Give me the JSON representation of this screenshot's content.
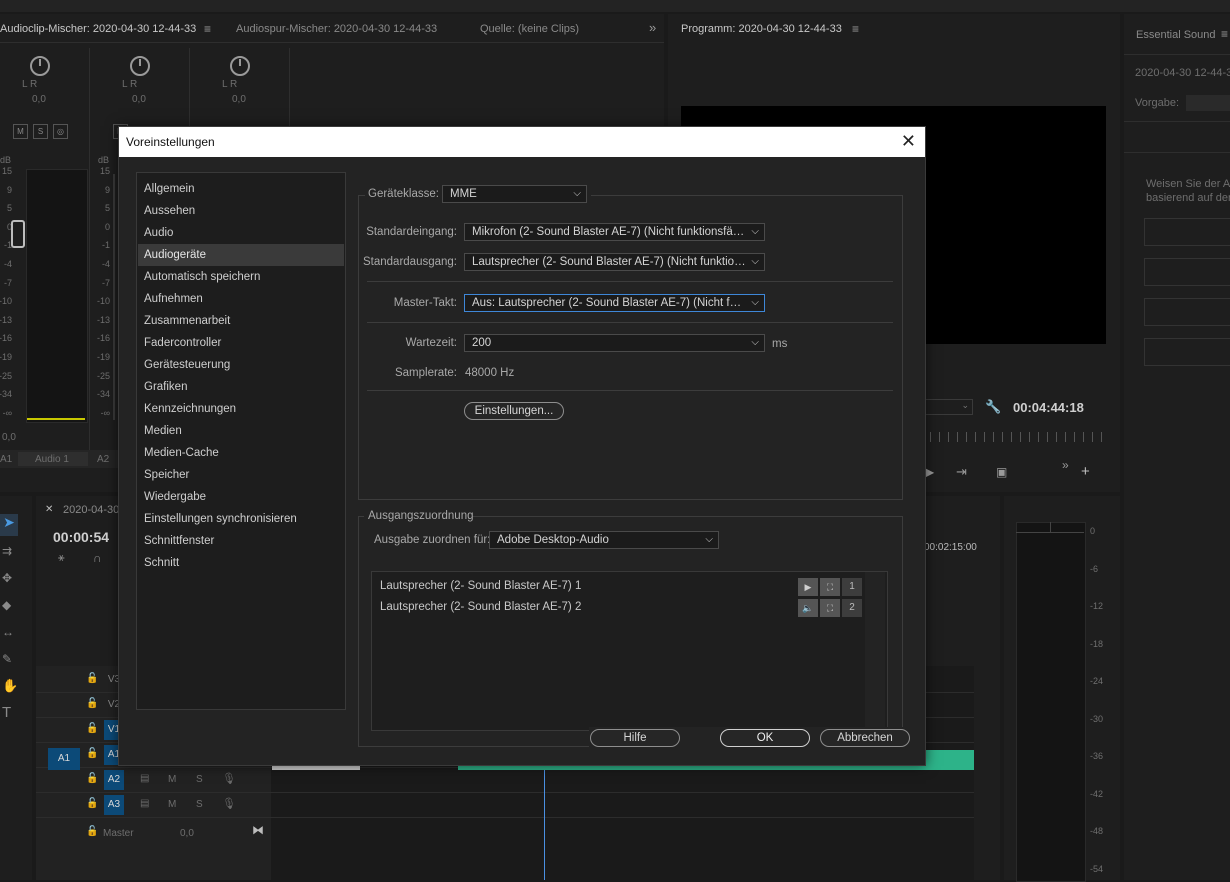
{
  "panels": {
    "audioclip_mixer_tab": "Audioclip-Mischer: 2020-04-30 12-44-33",
    "audiotrack_mixer_tab": "Audiospur-Mischer: 2020-04-30 12-44-33",
    "source_tab": "Quelle: (keine Clips)",
    "program_tab": "Programm: 2020-04-30 12-44-33",
    "essential_sound_tab": "Essential Sound",
    "essential_sound_seq": "2020-04-30 12-44-3",
    "essential_sound_preset": "Vorgabe:",
    "essential_sound_hint1": "Weisen Sie der A",
    "essential_sound_hint2": "basierend auf der",
    "program_timecode": "00:04:44:18",
    "timeline_tab": "2020-04-30",
    "timeline_timecode": "00:00:54",
    "timeline_ruler_time": "00:02:15:00",
    "channel_lr": "L R",
    "pan_value": "0,0",
    "db_label": "dB",
    "mixer_bottom_value": "0,0",
    "mixer_track_a1": "A1",
    "mixer_track_audio1": "Audio 1",
    "mixer_track_a2": "A2",
    "meter_scale": [
      "15",
      "9",
      "5",
      "0",
      "-1",
      "-4",
      "-7",
      "-10",
      "-13",
      "-16",
      "-19",
      "-25",
      "-34",
      "-∞"
    ],
    "right_meter_scale": [
      "0",
      "-6",
      "-12",
      "-18",
      "-24",
      "-30",
      "-36",
      "-42",
      "-48",
      "-54"
    ],
    "tracks": [
      "V3",
      "V2",
      "V1",
      "A1",
      "A2",
      "A3"
    ],
    "track_master": "Master",
    "track_master_value": "0,0",
    "source_patch_a1": "A1",
    "m_label": "M",
    "s_label": "S",
    "solo_label": "S"
  },
  "dialog": {
    "title": "Voreinstellungen",
    "close_glyph": "✕",
    "categories": [
      "Allgemein",
      "Aussehen",
      "Audio",
      "Audiogeräte",
      "Automatisch speichern",
      "Aufnehmen",
      "Zusammenarbeit",
      "Fadercontroller",
      "Gerätesteuerung",
      "Grafiken",
      "Kennzeichnungen",
      "Medien",
      "Medien-Cache",
      "Speicher",
      "Wiedergabe",
      "Einstellungen synchronisieren",
      "Schnittfenster",
      "Schnitt"
    ],
    "selected_category": "Audiogeräte",
    "device_class_label": "Geräteklasse:",
    "device_class_value": "MME",
    "default_input_label": "Standardeingang:",
    "default_input_value": "Mikrofon (2- Sound Blaster AE-7) (Nicht funktionsfähig)",
    "default_output_label": "Standardausgang:",
    "default_output_value": "Lautsprecher (2- Sound Blaster AE-7) (Nicht funktions...",
    "master_clock_label": "Master-Takt:",
    "master_clock_value": "Aus: Lautsprecher (2- Sound Blaster AE-7) (Nicht funk...",
    "latency_label": "Wartezeit:",
    "latency_value": "200",
    "latency_unit": "ms",
    "samplerate_label": "Samplerate:",
    "samplerate_value": "48000 Hz",
    "settings_button": "Einstellungen...",
    "output_mapping_label": "Ausgangszuordnung",
    "map_output_for_label": "Ausgabe zuordnen für:",
    "map_output_for_value": "Adobe Desktop-Audio",
    "mapping_rows": [
      {
        "name": "Lautsprecher (2- Sound Blaster AE-7) 1",
        "channel": "1"
      },
      {
        "name": "Lautsprecher (2- Sound Blaster AE-7) 2",
        "channel": "2"
      }
    ],
    "help_button": "Hilfe",
    "ok_button": "OK",
    "cancel_button": "Abbrechen"
  },
  "colors": {
    "accent": "#3e87d8",
    "track_blue": "#0c4a78",
    "waveform_green": "#2db389",
    "playhead": "#4a90e2"
  }
}
